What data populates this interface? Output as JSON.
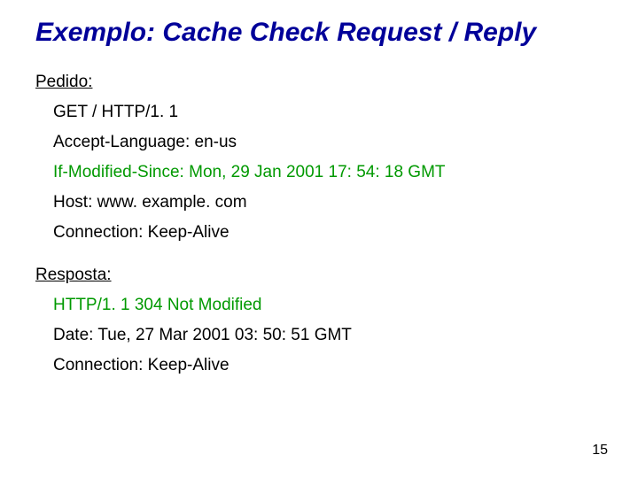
{
  "title": "Exemplo: Cache Check Request / Reply",
  "request": {
    "label": "Pedido:",
    "lines": {
      "l1": "GET / HTTP/1. 1",
      "l2": "Accept-Language: en-us",
      "l3": "If-Modified-Since: Mon, 29 Jan 2001 17: 54: 18 GMT",
      "l4": "Host: www. example. com",
      "l5": "Connection: Keep-Alive"
    }
  },
  "response": {
    "label": "Resposta:",
    "lines": {
      "l1": "HTTP/1. 1 304 Not Modified",
      "l2": "Date: Tue, 27 Mar 2001 03: 50: 51 GMT",
      "l3": "Connection: Keep-Alive"
    }
  },
  "page_number": "15"
}
